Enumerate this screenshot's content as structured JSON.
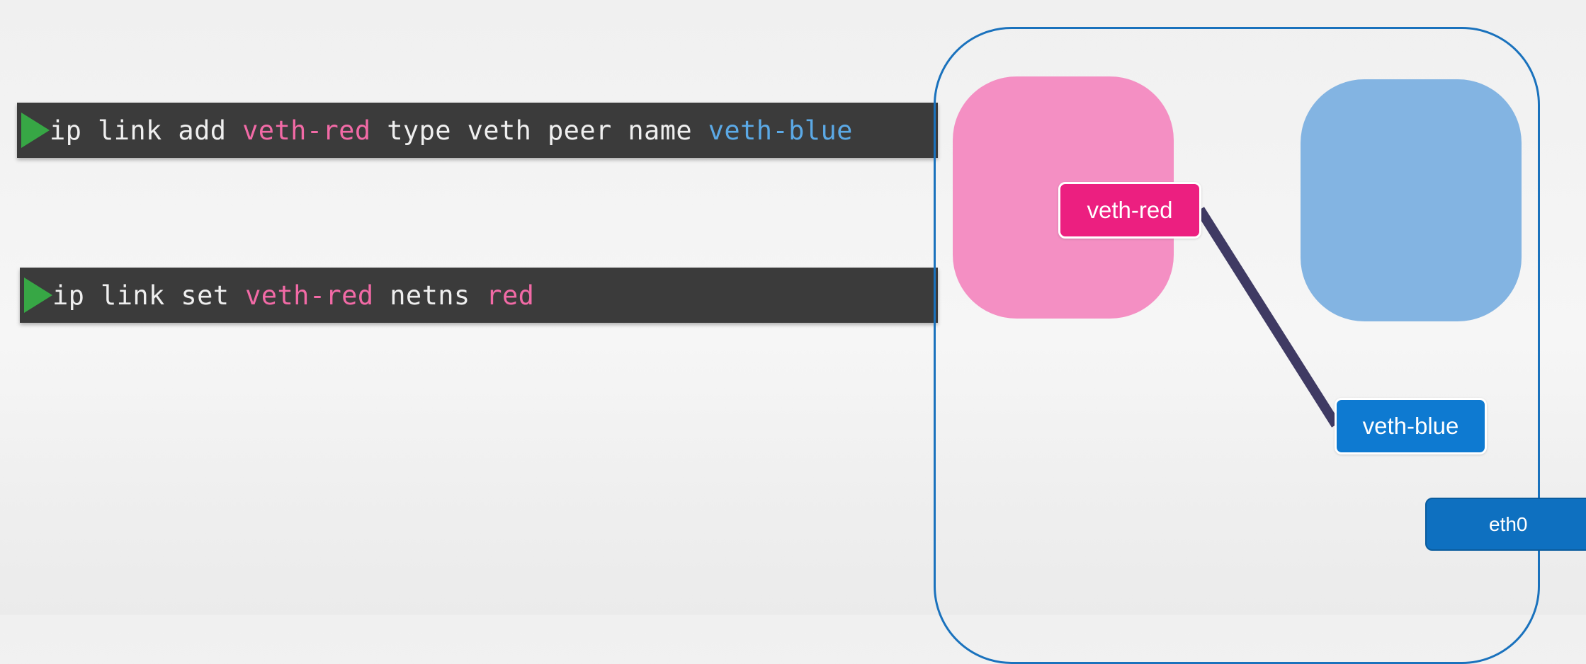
{
  "commands": [
    {
      "tokens": [
        {
          "text": "ip link add ",
          "style": "plain"
        },
        {
          "text": "veth-red",
          "style": "red"
        },
        {
          "text": " type veth peer name ",
          "style": "plain"
        },
        {
          "text": "veth-blue",
          "style": "blue"
        }
      ]
    },
    {
      "tokens": [
        {
          "text": "ip link set ",
          "style": "plain"
        },
        {
          "text": "veth-red",
          "style": "red"
        },
        {
          "text": " netns ",
          "style": "plain"
        },
        {
          "text": "red",
          "style": "red"
        }
      ]
    }
  ],
  "diagram": {
    "ports": {
      "veth_red": "veth-red",
      "veth_blue": "veth-blue",
      "eth0": "eth0"
    }
  },
  "colors": {
    "command_background": "#3b3b3b",
    "play_icon": "#37a745",
    "token_red": "#f26aa6",
    "token_blue": "#5ba9e6",
    "host_border": "#1a72bd",
    "namespace_red": "#f48fc3",
    "namespace_blue": "#83b4e2",
    "port_red": "#ec1f80",
    "port_blue": "#0e7ad1",
    "port_eth0": "#0e70c0",
    "link_cable": "#3f3a63"
  },
  "icons": [
    "play-icon"
  ]
}
